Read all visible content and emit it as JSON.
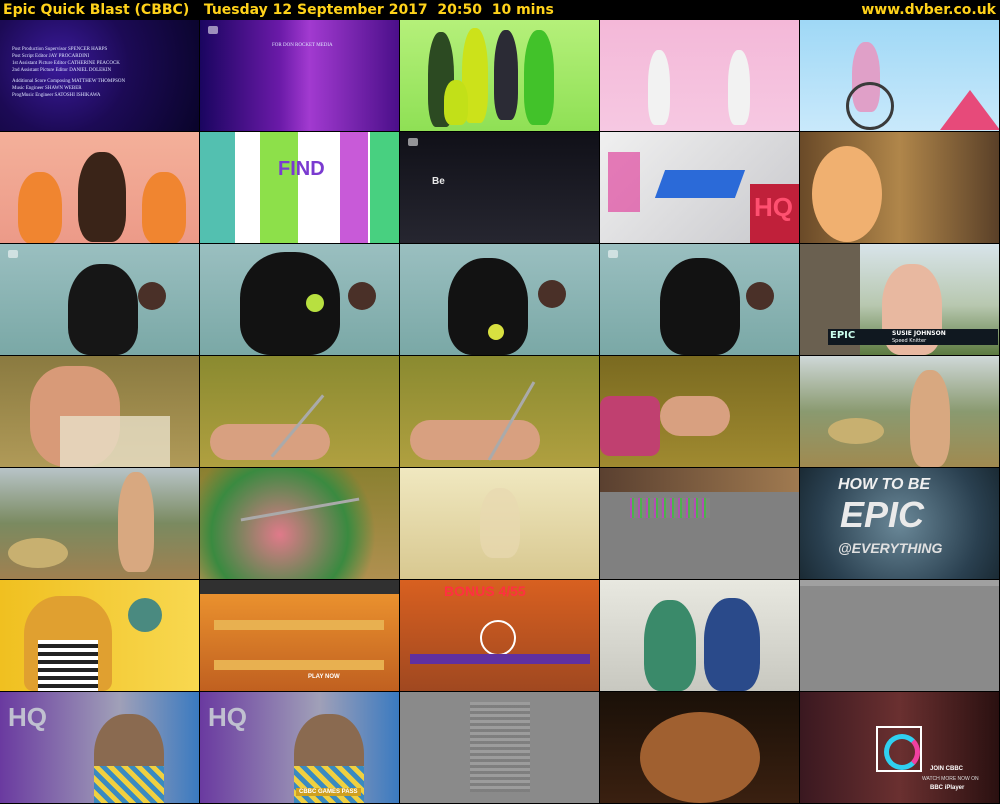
{
  "header": {
    "title": "Epic Quick Blast (CBBC)   Tuesday 12 September 2017  20:50  10 mins",
    "site": "www.dvber.co.uk"
  },
  "thumbnails": [
    {
      "id": 1,
      "credits": [
        "Post Production Supervisor   SPENCER HARPS",
        "Post Script Editor   JAY PROCARDINI",
        "1st Assistant Picture Editor   CATHERINE PEACOCK",
        "2nd Assistant Picture Editor   DANIEL DOLEKIN",
        "Additional Score Composing   MATTHEW THOMPSON",
        "Music Engineer   SHAWN WEBER",
        "ProgMusic Engineer   SATOSHI ISHIKAWA"
      ]
    },
    {
      "id": 2,
      "credits": [
        "FOR DON ROCKET MEDIA"
      ]
    },
    {
      "id": 3
    },
    {
      "id": 4
    },
    {
      "id": 5
    },
    {
      "id": 6
    },
    {
      "id": 7,
      "sign": "FIND"
    },
    {
      "id": 8,
      "sign": "Be"
    },
    {
      "id": 9,
      "sign": "HQ"
    },
    {
      "id": 10
    },
    {
      "id": 11
    },
    {
      "id": 12
    },
    {
      "id": 13
    },
    {
      "id": 14
    },
    {
      "id": 15,
      "lower_third": {
        "brand": "EPIC",
        "name": "SUSIE JOHNSON",
        "role": "Speed Knitter"
      }
    },
    {
      "id": 16
    },
    {
      "id": 17
    },
    {
      "id": 18
    },
    {
      "id": 19
    },
    {
      "id": 20
    },
    {
      "id": 21
    },
    {
      "id": 22
    },
    {
      "id": 23
    },
    {
      "id": 24
    },
    {
      "id": 25,
      "headline": [
        "HOW TO BE",
        "EPIC",
        "@EVERYTHING"
      ]
    },
    {
      "id": 26
    },
    {
      "id": 27,
      "hud": "PLAY NOW"
    },
    {
      "id": 28,
      "hud": "BONUS 4/55"
    },
    {
      "id": 29
    },
    {
      "id": 30
    },
    {
      "id": 31,
      "sign": "HQ"
    },
    {
      "id": 32,
      "sign": "HQ",
      "caption": "CBBC GAMES PASS"
    },
    {
      "id": 33
    },
    {
      "id": 34
    },
    {
      "id": 35,
      "endcard": [
        "JOIN CBBC",
        "WATCH MORE NOW ON",
        "BBC iPlayer"
      ]
    }
  ]
}
